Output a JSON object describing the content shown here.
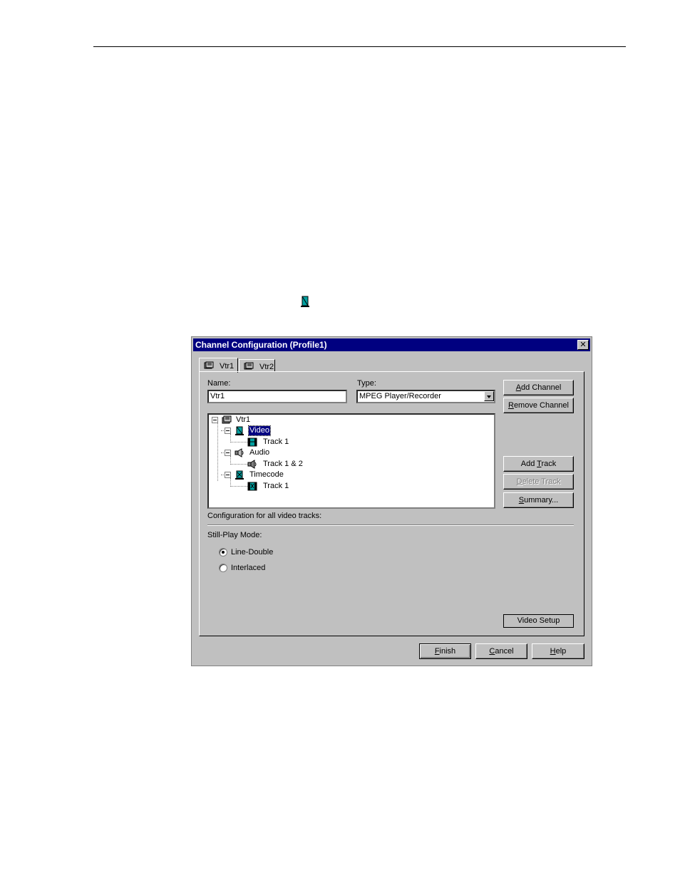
{
  "dialog": {
    "title": "Channel Configuration (Profile1)",
    "close_symbol": "✕"
  },
  "tabs": [
    {
      "label": "Vtr1",
      "icon": "vtr-icon",
      "active": true
    },
    {
      "label": "Vtr2",
      "icon": "vtr-icon",
      "active": false
    }
  ],
  "form": {
    "name_label": "Name:",
    "name_value": "Vtr1",
    "type_label": "Type:",
    "type_value": "MPEG Player/Recorder"
  },
  "tree": {
    "root": "Vtr1",
    "video": "Video",
    "video_track": "Track 1",
    "audio": "Audio",
    "audio_track": "Track 1 & 2",
    "timecode": "Timecode",
    "timecode_track": "Track 1",
    "selected": "Video"
  },
  "buttons": {
    "add_channel_pre": "",
    "add_channel_key": "A",
    "add_channel_post": "dd Channel",
    "remove_channel_pre": "",
    "remove_channel_key": "R",
    "remove_channel_post": "emove Channel",
    "add_track_pre": "Add ",
    "add_track_key": "T",
    "add_track_post": "rack",
    "delete_track_pre": "",
    "delete_track_key": "D",
    "delete_track_post": "elete Track",
    "summary_pre": "",
    "summary_key": "S",
    "summary_post": "ummary...",
    "video_setup": "Video Setup",
    "finish_pre": "",
    "finish_key": "F",
    "finish_post": "inish",
    "cancel_pre": "",
    "cancel_key": "C",
    "cancel_post": "ancel",
    "help_pre": "",
    "help_key": "H",
    "help_post": "elp"
  },
  "config": {
    "heading": "Configuration for all video tracks:",
    "still_play_label": "Still-Play Mode:",
    "option_line_double": "Line-Double",
    "option_interlaced": "Interlaced",
    "selected": "Line-Double"
  },
  "colors": {
    "title_bar": "#000080",
    "dialog_face": "#c0c0c0",
    "selection": "#000080",
    "video_icon": "#00a0a0"
  }
}
